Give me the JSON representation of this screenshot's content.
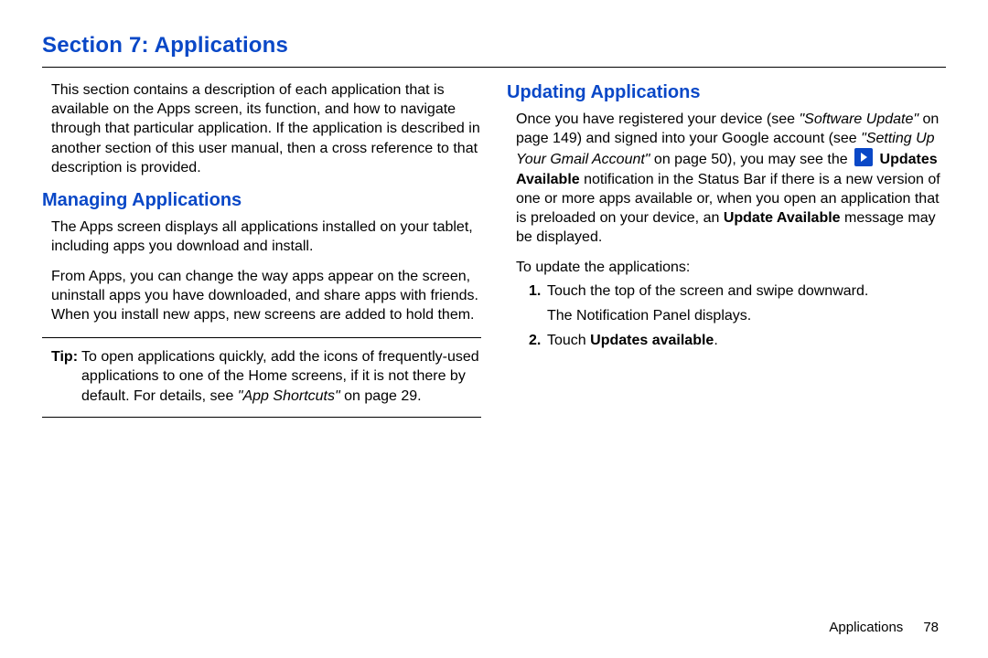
{
  "section_title": "Section 7: Applications",
  "left": {
    "intro": "This section contains a description of each application that is available on the Apps screen, its function, and how to navigate through that particular application. If the application is described in another section of this user manual, then a cross reference to that description is provided.",
    "managing_h": "Managing Applications",
    "managing_p1": "The Apps screen displays all applications installed on your tablet, including apps you download and install.",
    "managing_p2": "From Apps, you can change the way apps appear on the screen, uninstall apps you have downloaded, and share apps with friends. When you install new apps, new screens are added to hold them.",
    "tip_label": "Tip:",
    "tip_pre": "To open applications quickly, add the icons of frequently-used applications to one of the Home screens, if it is not there by default. For details, see ",
    "tip_link": "\"App Shortcuts\"",
    "tip_post": " on page 29."
  },
  "right": {
    "updating_h": "Updating Applications",
    "up_p1_a": "Once you have registered your device (see ",
    "up_p1_link1": "\"Software Update\"",
    "up_p1_b": " on page 149) and signed into your Google account (see ",
    "up_p1_link2": "\"Setting Up Your Gmail Account\"",
    "up_p1_c": " on page 50), you may see the ",
    "up_p1_bold1": "Updates Available",
    "up_p1_d": " notification in the Status Bar if there is a new version of one or more apps available or, when you open an application that is preloaded on your device, an ",
    "up_p1_bold2": "Update Available",
    "up_p1_e": " message may be displayed.",
    "up_p2": "To update the applications:",
    "step1_num": "1.",
    "step1_a": "Touch the top of the screen and swipe downward.",
    "step1_b": "The Notification Panel displays.",
    "step2_num": "2.",
    "step2_pre": "Touch ",
    "step2_bold": "Updates available",
    "step2_post": "."
  },
  "footer": {
    "name": "Applications",
    "page": "78"
  }
}
